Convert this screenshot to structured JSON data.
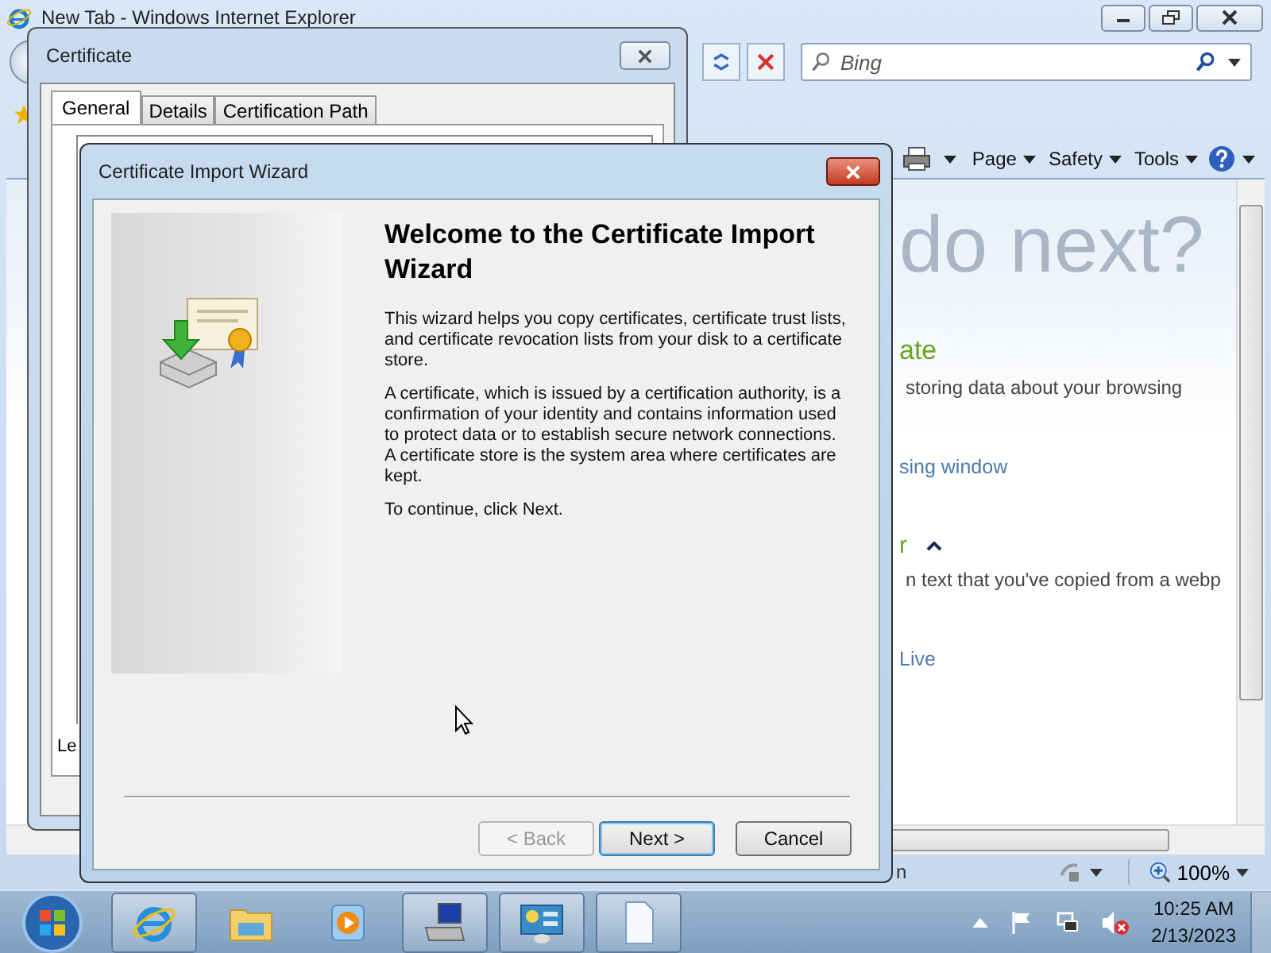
{
  "browser": {
    "title": "New Tab - Windows Internet Explorer",
    "search": {
      "placeholder": "Bing"
    },
    "command_bar": [
      {
        "label": "Page"
      },
      {
        "label": "Safety"
      },
      {
        "label": "Tools"
      }
    ],
    "content": [
      {
        "kind": "heading",
        "text": "do next?"
      },
      {
        "kind": "subheading",
        "text": "ate"
      },
      {
        "kind": "text",
        "text": "storing data about your browsing"
      },
      {
        "kind": "link",
        "text": "sing window"
      },
      {
        "kind": "section",
        "text": "r"
      },
      {
        "kind": "text",
        "text": "n text that you've copied from a webp"
      },
      {
        "kind": "link",
        "text": "Live"
      }
    ],
    "status_text": "n",
    "zoom": "100%"
  },
  "certificate": {
    "title": "Certificate",
    "tabs": [
      {
        "label": "General",
        "selected": true
      },
      {
        "label": "Details",
        "selected": false
      },
      {
        "label": "Certification Path",
        "selected": false
      }
    ],
    "footer_text": "Le"
  },
  "wizard": {
    "title": "Certificate Import Wizard",
    "heading": "Welcome to the Certificate Import Wizard",
    "paragraphs": [
      "This wizard helps you copy certificates, certificate trust lists, and certificate revocation lists from your disk to a certificate store.",
      "A certificate, which is issued by a certification authority, is a confirmation of your identity and contains information used to protect data or to establish secure network connections. A certificate store is the system area where certificates are kept.",
      "To continue, click Next."
    ],
    "buttons": [
      {
        "label": "< Back",
        "disabled": true,
        "default": false
      },
      {
        "label": "Next >",
        "disabled": false,
        "default": true
      },
      {
        "label": "Cancel",
        "disabled": false,
        "default": false
      }
    ]
  },
  "taskbar": {
    "apps": [
      {
        "kind": "ie",
        "running": true
      },
      {
        "kind": "folder",
        "running": false
      },
      {
        "kind": "media",
        "running": false
      },
      {
        "kind": "computer",
        "running": true
      },
      {
        "kind": "panel",
        "running": true
      },
      {
        "kind": "document",
        "running": true
      }
    ],
    "time": "10:25 AM",
    "date": "2/13/2023"
  }
}
